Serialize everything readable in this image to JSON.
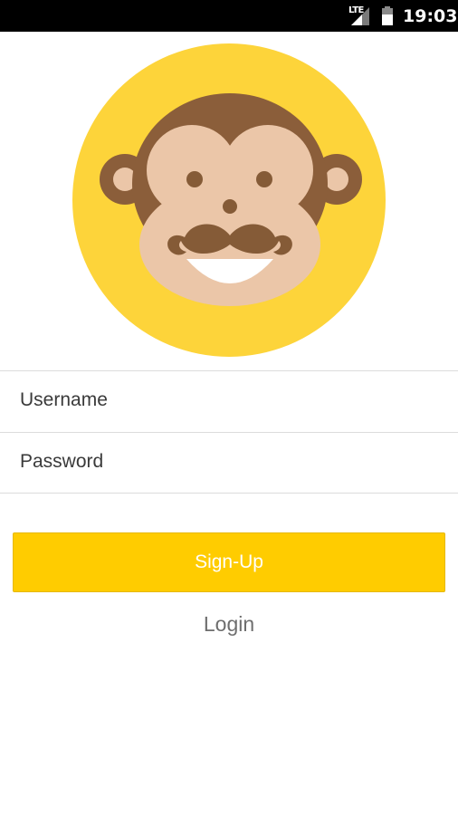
{
  "status_bar": {
    "network": "LTE",
    "time": "19:03"
  },
  "logo": {
    "icon": "monkey-mustache-icon",
    "colors": {
      "background": "#fdd43a",
      "fur": "#8b5e3a",
      "face": "#ebc6a8",
      "mustache": "#855b37"
    }
  },
  "form": {
    "username_placeholder": "Username",
    "password_placeholder": "Password"
  },
  "actions": {
    "signup_label": "Sign-Up",
    "login_label": "Login"
  },
  "colors": {
    "accent": "#ffcc00",
    "link": "#6e6e6e"
  }
}
